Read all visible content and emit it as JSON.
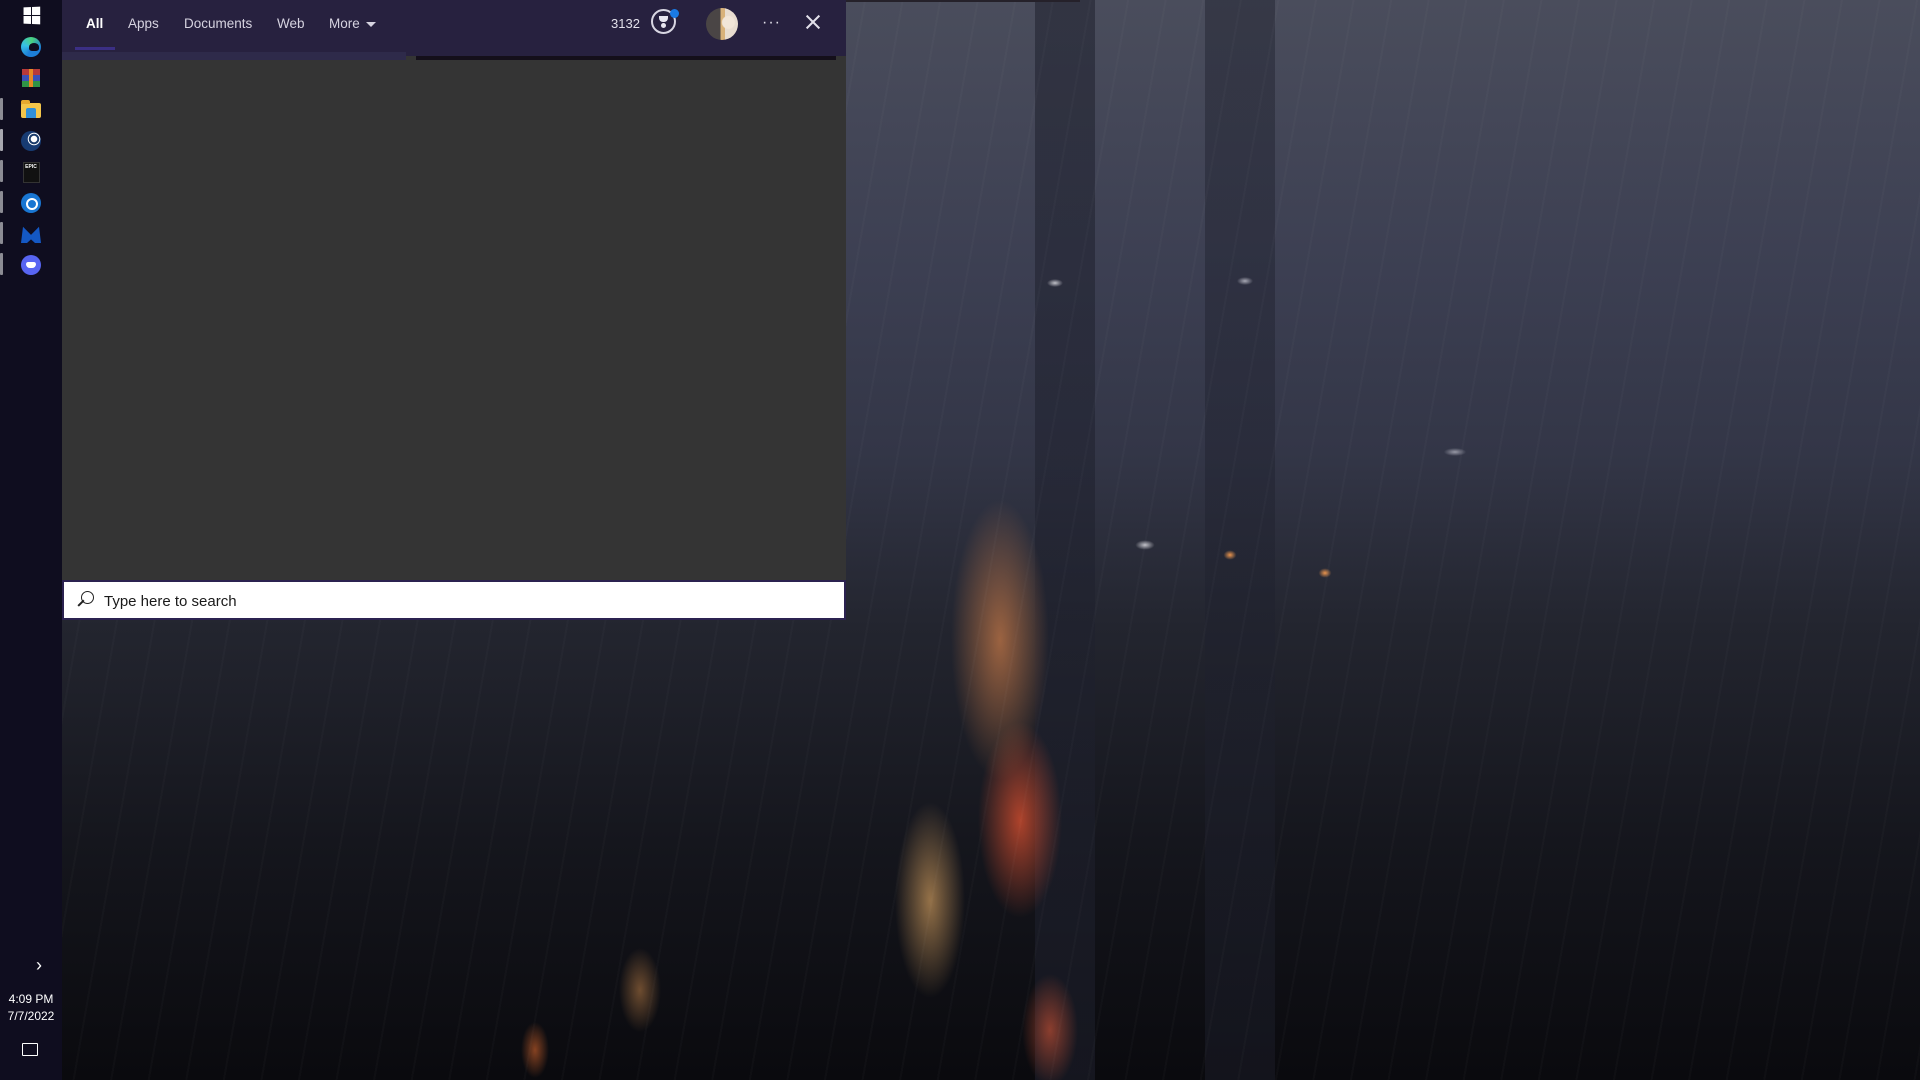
{
  "taskbar": {
    "pinned": [
      {
        "name": "start",
        "icon": "windows-icon"
      },
      {
        "name": "microsoft-edge",
        "icon": "edge-icon"
      },
      {
        "name": "winrar",
        "icon": "winrar-icon"
      },
      {
        "name": "file-explorer",
        "icon": "folder-icon"
      },
      {
        "name": "steam",
        "icon": "steam-icon"
      },
      {
        "name": "epic-games",
        "icon": "epic-games-icon",
        "label": "EPIC"
      },
      {
        "name": "battle-net",
        "icon": "battlenet-icon"
      },
      {
        "name": "malwarebytes",
        "icon": "malwarebytes-icon"
      },
      {
        "name": "discord",
        "icon": "discord-icon"
      }
    ],
    "show_hidden_icon": "chevron-right-icon",
    "show_hidden_glyph": "›",
    "time": "4:09 PM",
    "date": "7/7/2022",
    "notification_icon": "action-center-icon"
  },
  "search_panel": {
    "tabs": [
      {
        "label": "All",
        "active": true
      },
      {
        "label": "Apps",
        "active": false
      },
      {
        "label": "Documents",
        "active": false
      },
      {
        "label": "Web",
        "active": false
      },
      {
        "label": "More",
        "active": false,
        "has_dropdown": true
      }
    ],
    "rewards_points": "3132",
    "rewards_icon": "rewards-trophy-icon",
    "rewards_notification": true,
    "more_options_glyph": "···",
    "close_icon": "close-icon",
    "search": {
      "placeholder": "Type here to search",
      "value": ""
    }
  },
  "colors": {
    "header_bg": "#27213f",
    "accent_underline": "#3b2f84",
    "results_bg": "#343434",
    "taskbar_bg": "#0f0d1f",
    "notification_dot": "#1a7be6"
  }
}
